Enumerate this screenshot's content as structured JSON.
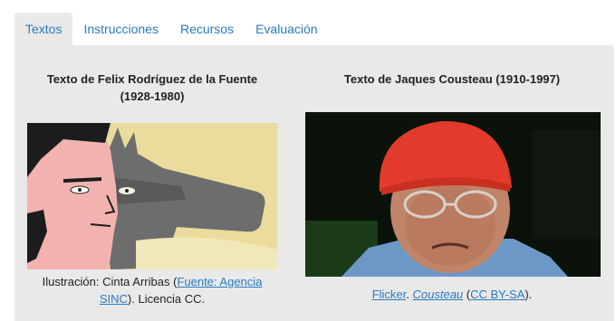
{
  "tabs": [
    {
      "label": "Textos",
      "active": true
    },
    {
      "label": "Instrucciones",
      "active": false
    },
    {
      "label": "Recursos",
      "active": false
    },
    {
      "label": "Evaluación",
      "active": false
    }
  ],
  "left": {
    "title_line1": "Texto de Felix Rodríguez de la Fuente",
    "title_line2": "(1928-1980)",
    "caption_pre": "Ilustración: Cinta Arribas (",
    "caption_link": "Fuente: Agencia SINC",
    "caption_post": "). Licencia CC."
  },
  "right": {
    "title": "Texto de Jaques Cousteau (1910-1997)",
    "link1": "Flicker",
    "sep1": ". ",
    "link2": "Cousteau",
    "sep2": " (",
    "link3": "CC BY-SA",
    "sep3": ")."
  },
  "colors": {
    "link": "#2a7ac0",
    "panel": "#e9e9e9"
  }
}
